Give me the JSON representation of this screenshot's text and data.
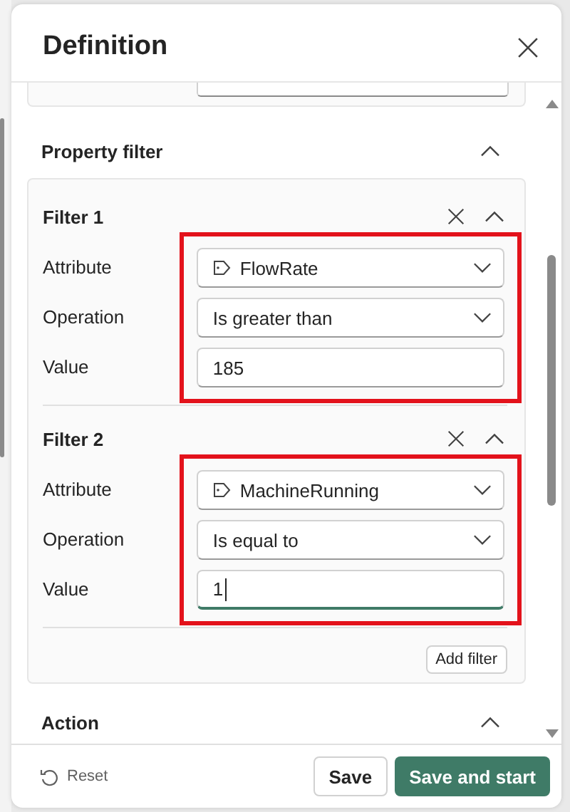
{
  "title": "Definition",
  "property_filter": {
    "heading": "Property filter",
    "expanded": true,
    "filters": [
      {
        "title": "Filter 1",
        "expanded": true,
        "highlighted": true,
        "fields": [
          {
            "kind": "tag-select",
            "label": "Attribute",
            "value": "FlowRate"
          },
          {
            "kind": "select",
            "label": "Operation",
            "value": "Is greater than"
          },
          {
            "kind": "text",
            "label": "Value",
            "value": "185",
            "focused": false
          }
        ]
      },
      {
        "title": "Filter 2",
        "expanded": true,
        "highlighted": true,
        "fields": [
          {
            "kind": "tag-select",
            "label": "Attribute",
            "value": "MachineRunning"
          },
          {
            "kind": "select",
            "label": "Operation",
            "value": "Is equal to"
          },
          {
            "kind": "text",
            "label": "Value",
            "value": "1",
            "focused": true
          }
        ]
      }
    ],
    "add_filter": "Add filter"
  },
  "action": {
    "heading": "Action",
    "expanded": true
  },
  "footer": {
    "reset": "Reset",
    "save": "Save",
    "save_and_start": "Save and start"
  }
}
